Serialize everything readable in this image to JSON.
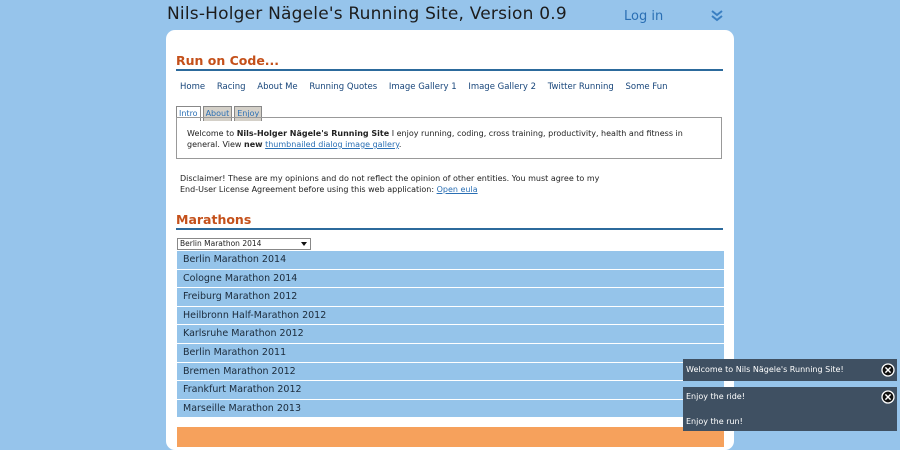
{
  "header": {
    "title": "Nils-Holger Nägele's Running Site, Version 0.9",
    "login": "Log in"
  },
  "sections": {
    "run_on_code": "Run on Code...",
    "marathons": "Marathons"
  },
  "nav": [
    "Home",
    "Racing",
    "About Me",
    "Running Quotes",
    "Image Gallery 1",
    "Image Gallery 2",
    "Twitter Running",
    "Some Fun"
  ],
  "tabs": [
    "Intro",
    "About",
    "Enjoy"
  ],
  "intro": {
    "text1": "Welcome to ",
    "site_name": "Nils-Holger Nägele's Running Site",
    "text2": " I enjoy running, coding, cross training, productivity, health and fitness in general. View ",
    "new_word": "new",
    "gallery_link": "thumbnailed dialog image gallery",
    "period": "."
  },
  "disclaimer": {
    "text": "Disclaimer! These are my opinions and do not reflect the opinion of other entities. You must agree to my End-User License Agreement before using this web application: ",
    "link": "Open eula"
  },
  "select": {
    "value": "Berlin Marathon 2014"
  },
  "marathons": [
    "Berlin Marathon 2014",
    "Cologne Marathon 2014",
    "Freiburg Marathon 2012",
    "Heilbronn Half-Marathon 2012",
    "Karlsruhe Marathon 2012",
    "Berlin Marathon 2011",
    "Bremen Marathon 2012",
    "Frankfurt Marathon 2012",
    "Marseille Marathon 2013"
  ],
  "toasts": {
    "welcome": "Welcome to Nils Nägele's Running Site!",
    "enjoy_ride": "Enjoy the ride!",
    "enjoy_run": "Enjoy the run!"
  },
  "colors": {
    "background": "#96c4eb",
    "heading": "#c4501a",
    "list_item": "#95c4ea",
    "orange_bar": "#f6a15c",
    "toast": "#3f5062"
  }
}
